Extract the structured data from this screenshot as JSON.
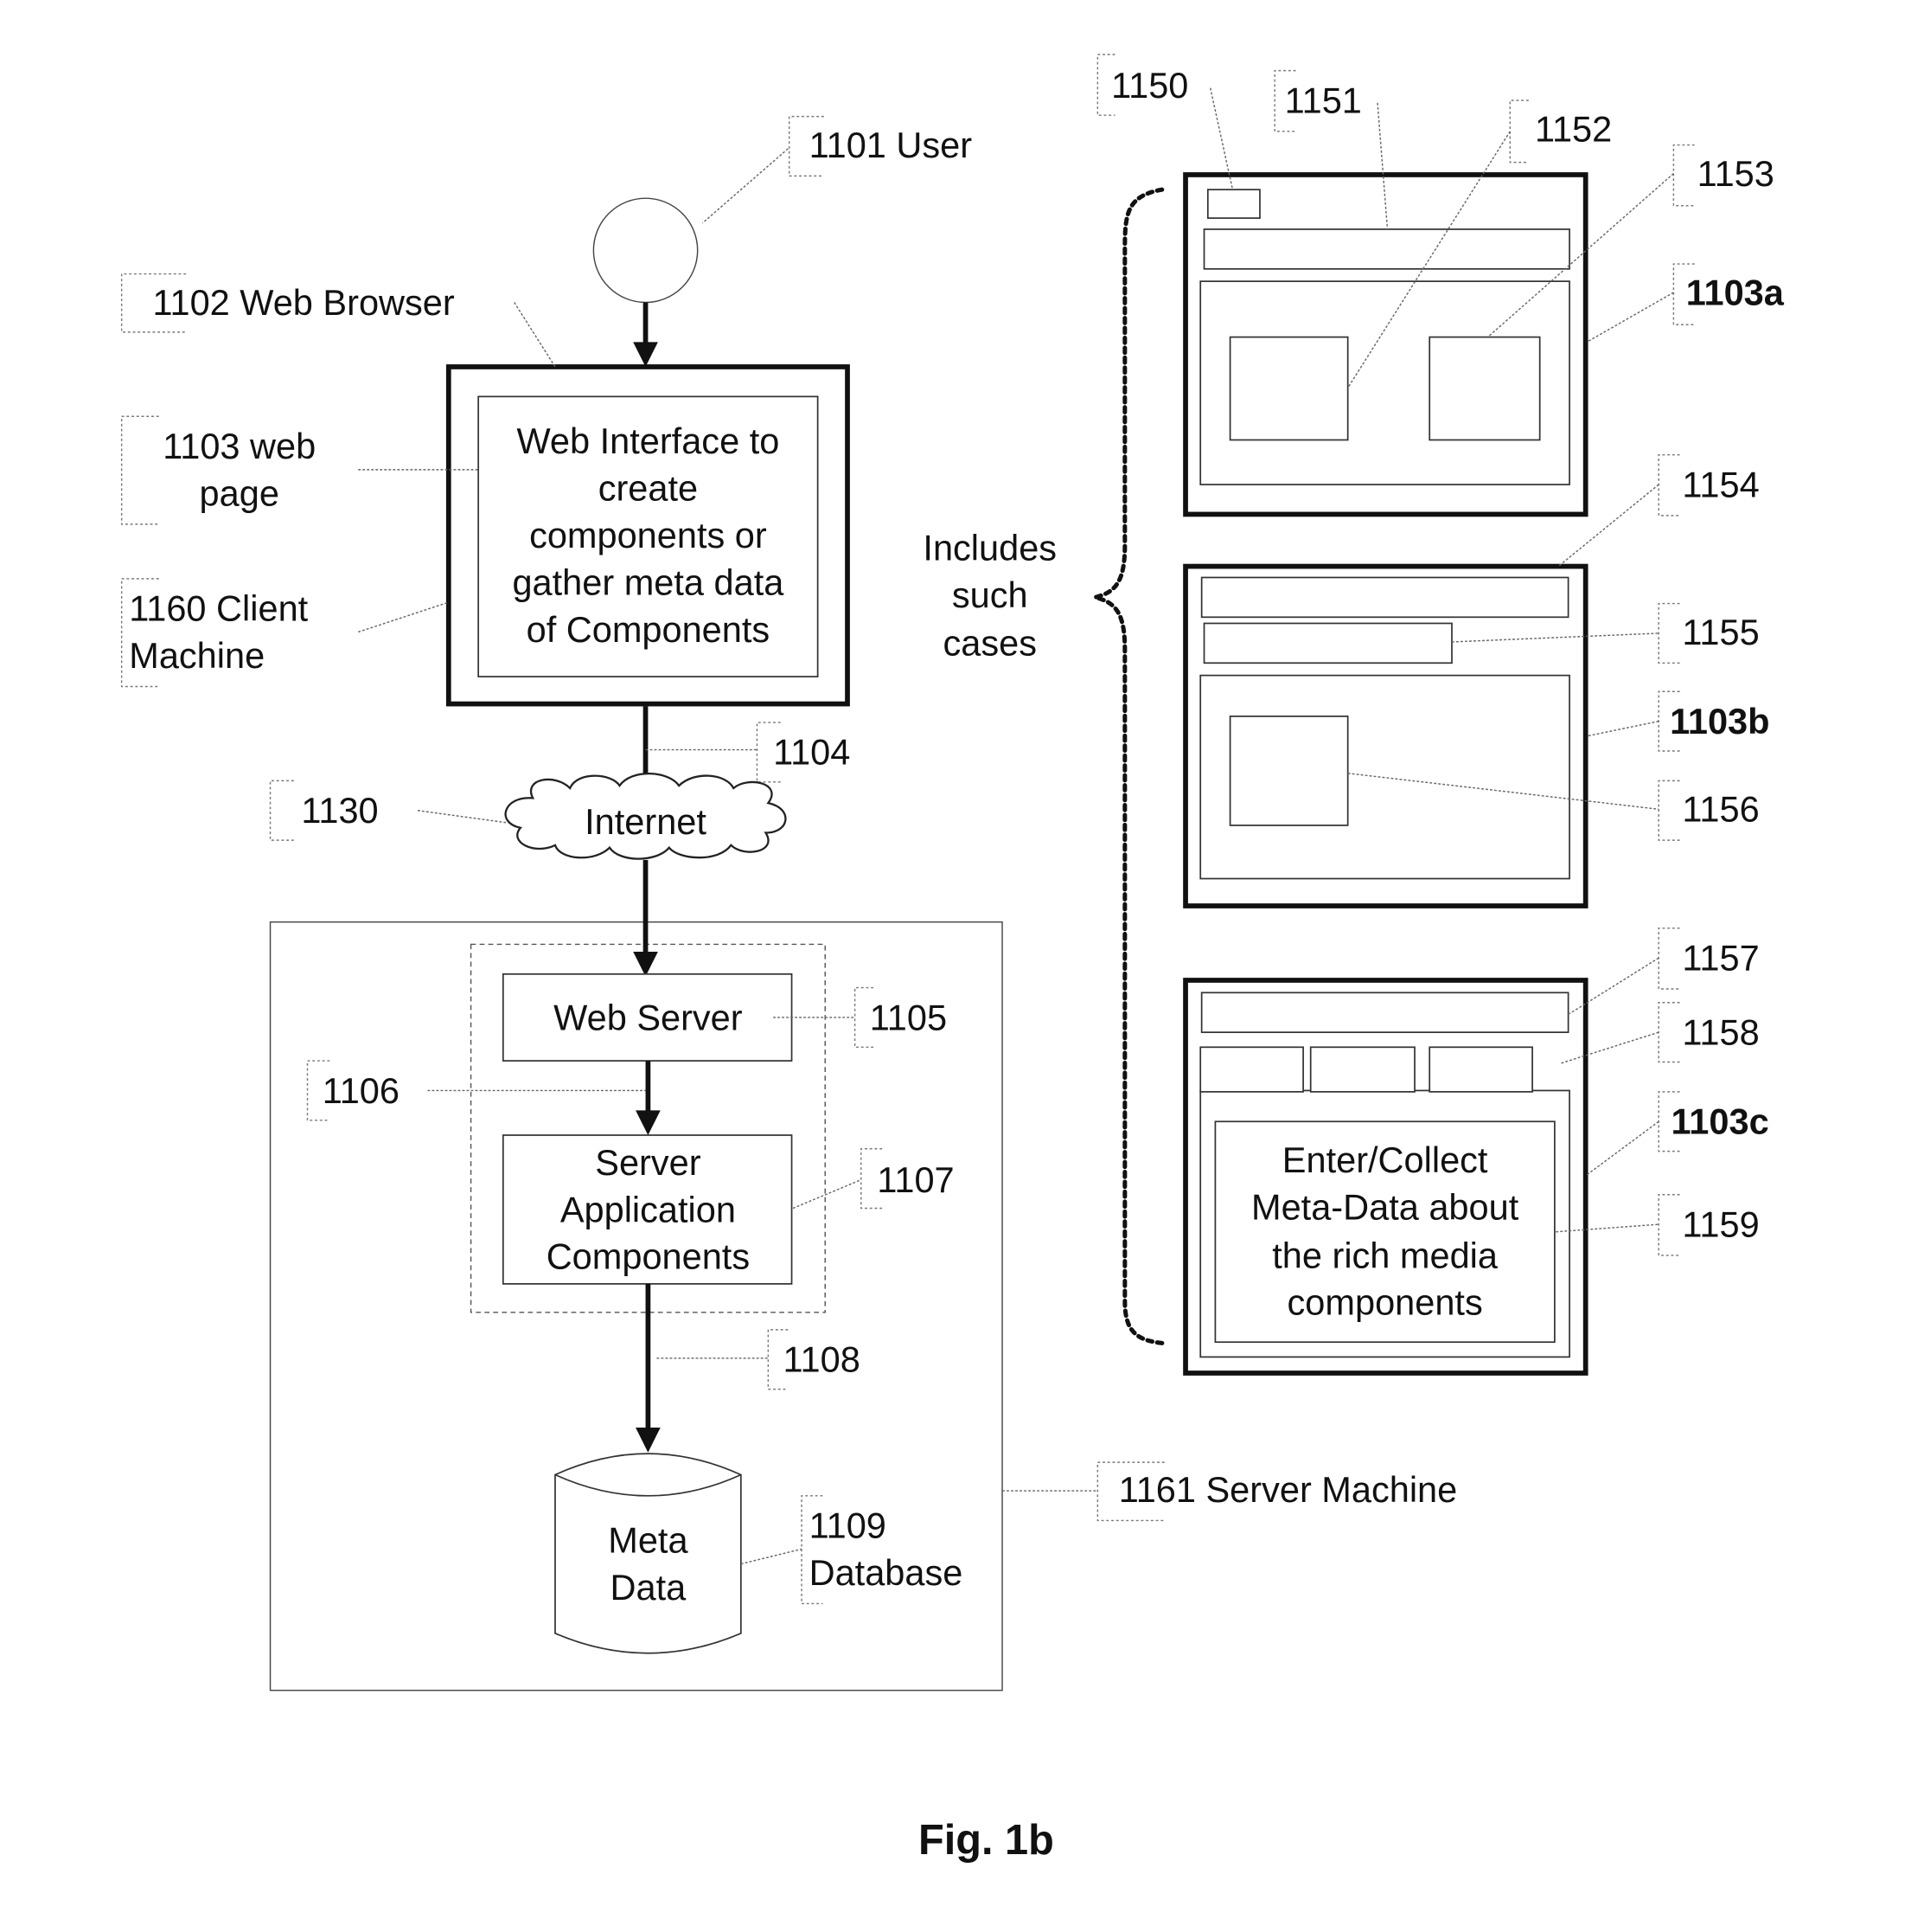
{
  "figure": {
    "caption": "Fig. 1b"
  },
  "labels": {
    "user": "1101 User",
    "web_browser": "1102 Web Browser",
    "web_page_line1": "1103 web",
    "web_page_line2": "page",
    "client_machine_line1": "1160 Client",
    "client_machine_line2": "Machine",
    "conn_1104": "1104",
    "internet_ref": "1130",
    "web_server_ref": "1105",
    "conn_1106": "1106",
    "server_app_ref": "1107",
    "conn_1108": "1108",
    "database_line1": "1109",
    "database_line2": "Database",
    "server_machine": "1161 Server Machine",
    "ref_1150": "1150",
    "ref_1151": "1151",
    "ref_1152": "1152",
    "ref_1153": "1153",
    "ref_1103a": "1103a",
    "ref_1154": "1154",
    "ref_1155": "1155",
    "ref_1103b": "1103b",
    "ref_1156": "1156",
    "ref_1157": "1157",
    "ref_1158": "1158",
    "ref_1103c": "1103c",
    "ref_1159": "1159"
  },
  "nodes": {
    "web_interface_lines": [
      "Web Interface to",
      "create",
      "components or",
      "gather meta data",
      "of Components"
    ],
    "internet": "Internet",
    "web_server": "Web Server",
    "server_app_lines": [
      "Server",
      "Application",
      "Components"
    ],
    "meta_data_lines": [
      "Meta",
      "Data"
    ],
    "includes_lines": [
      "Includes",
      "such",
      "cases"
    ],
    "page_c_lines": [
      "Enter/Collect",
      "Meta-Data about",
      "the rich media",
      "components"
    ]
  }
}
